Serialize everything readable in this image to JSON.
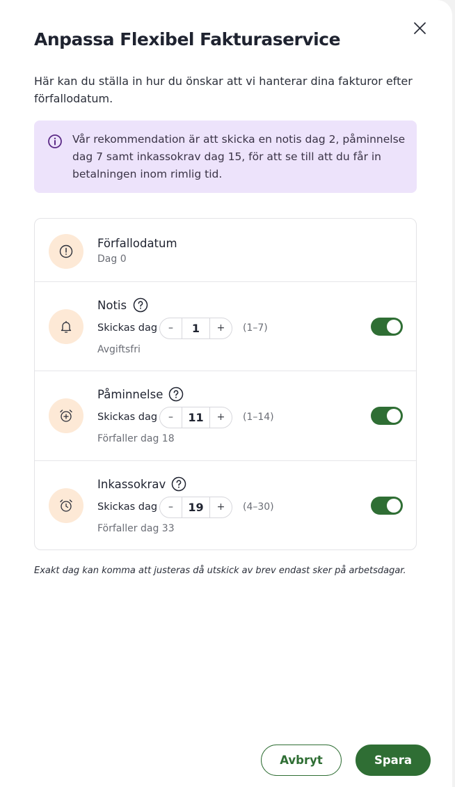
{
  "dialog": {
    "title": "Anpassa Flexibel Fakturaservice",
    "intro": "Här kan du ställa in hur du önskar att vi hanterar dina fakturor efter förfallodatum.",
    "close_icon": "close-icon"
  },
  "info": {
    "icon": "info-icon",
    "text": "Vår rekommendation är att skicka en notis dag 2, påminnelse dag 7 samt inkassokrav dag 15, för att se till att du får in betalningen inom rimlig tid."
  },
  "steps": {
    "due": {
      "icon": "alert-circle-icon",
      "label": "Förfallodatum",
      "sub": "Dag 0"
    },
    "notice": {
      "icon": "bell-icon",
      "label": "Notis",
      "send_label": "Skickas dag",
      "minus": "–",
      "value": "1",
      "plus": "+",
      "range": "(1–7)",
      "sub": "Avgiftsfri",
      "enabled": true
    },
    "reminder": {
      "icon": "alarm-plus-icon",
      "label": "Påminnelse",
      "send_label": "Skickas dag",
      "minus": "–",
      "value": "11",
      "plus": "+",
      "range": "(1–14)",
      "sub": "Förfaller dag 18",
      "enabled": true
    },
    "collection": {
      "icon": "alarm-clock-icon",
      "label": "Inkassokrav",
      "send_label": "Skickas dag",
      "minus": "–",
      "value": "19",
      "plus": "+",
      "range": "(4–30)",
      "sub": "Förfaller dag 33",
      "enabled": true
    }
  },
  "footnote": "Exakt dag kan komma att justeras då utskick av brev endast sker på arbetsdagar.",
  "actions": {
    "cancel": "Avbryt",
    "save": "Spara"
  },
  "colors": {
    "accent": "#2f6e34",
    "info_bg": "#ede3fb",
    "info_icon": "#5b2a86",
    "icon_bg": "#fde9d6"
  }
}
